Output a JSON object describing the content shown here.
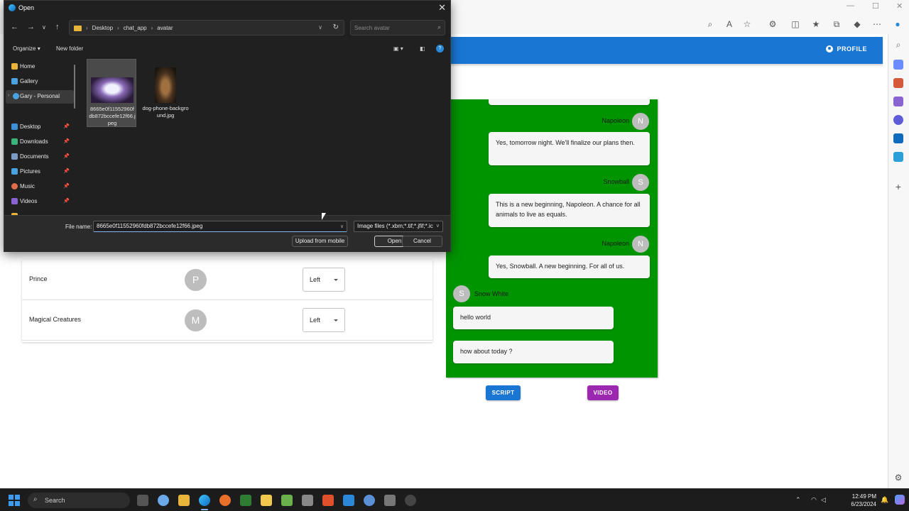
{
  "browser": {
    "profile_label": "PROFILE"
  },
  "characters": [
    {
      "name": "Prince",
      "initial": "P",
      "side": "Left"
    },
    {
      "name": "Magical Creatures",
      "initial": "M",
      "side": "Left"
    }
  ],
  "chat": {
    "messages": [
      {
        "speaker": "Napoleon",
        "initial": "N",
        "align": "right",
        "text": "Yes, tomorrow night. We'll finalize our plans then."
      },
      {
        "speaker": "Snowball",
        "initial": "S",
        "align": "right",
        "text": "This is a new beginning, Napoleon. A chance for all animals to live as equals."
      },
      {
        "speaker": "Napoleon",
        "initial": "N",
        "align": "right",
        "text": "Yes, Snowball. A new beginning. For all of us."
      },
      {
        "speaker": "Snow White",
        "initial": "S",
        "align": "left",
        "text": "hello world"
      },
      {
        "speaker": "",
        "initial": "",
        "align": "left",
        "text": "how about today ?"
      }
    ],
    "script_button": "SCRIPT",
    "video_button": "VIDEO",
    "script_color": "#1976d2",
    "video_color": "#9c27b0",
    "panel_color": "#009400"
  },
  "dialog": {
    "title": "Open",
    "breadcrumbs": [
      "Desktop",
      "chat_app",
      "avatar"
    ],
    "search_placeholder": "Search avatar",
    "organize": "Organize",
    "new_folder": "New folder",
    "nav": [
      {
        "label": "Home",
        "pinned": false
      },
      {
        "label": "Gallery",
        "pinned": false
      },
      {
        "label": "Gary - Personal",
        "pinned": false
      },
      {
        "label": "Desktop",
        "pinned": true
      },
      {
        "label": "Downloads",
        "pinned": true
      },
      {
        "label": "Documents",
        "pinned": true
      },
      {
        "label": "Pictures",
        "pinned": true
      },
      {
        "label": "Music",
        "pinned": true
      },
      {
        "label": "Videos",
        "pinned": true
      }
    ],
    "files": [
      {
        "name": "8665e0f11552960fdb872bccefe12f66.jpeg"
      },
      {
        "name": "dog-phone-background.jpg"
      }
    ],
    "file_name_label": "File name:",
    "file_name_value": "8665e0f11552960fdb872bccefe12f66.jpeg",
    "file_type": "Image files (*.xbm;*.tif;*.jfif;*.ic",
    "upload_button": "Upload from mobile",
    "open_button": "Open",
    "cancel_button": "Cancel"
  },
  "taskbar": {
    "search_label": "Search",
    "time": "12:49 PM",
    "date": "6/23/2024"
  }
}
